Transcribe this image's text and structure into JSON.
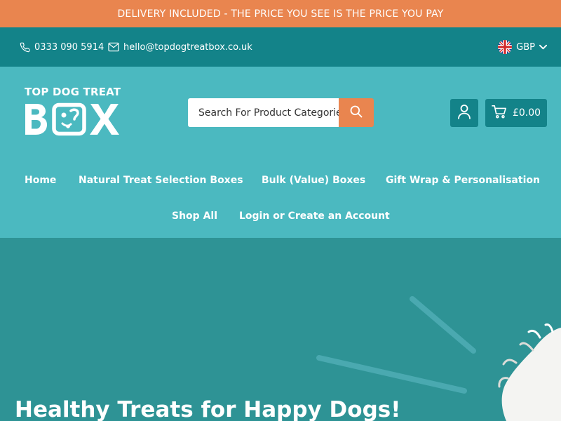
{
  "announcement": {
    "text": "DELIVERY INCLUDED - THE PRICE YOU SEE IS THE PRICE YOU PAY"
  },
  "contact": {
    "phone": "0333 090 5914",
    "email": "hello@topdogtreatbox.co.uk",
    "currency": "GBP",
    "icons": {
      "phone": "phone-icon",
      "email": "envelope-icon",
      "flag": "uk-flag-icon",
      "chevron": "chevron-down-icon"
    }
  },
  "logo": {
    "top_text": "TOP DOG TREAT",
    "bottom_text": "BOX"
  },
  "search": {
    "placeholder": "Search For Product Categories",
    "icon": "search-icon"
  },
  "account": {
    "icon": "user-icon"
  },
  "cart": {
    "total": "£0.00",
    "icon": "cart-icon"
  },
  "nav": {
    "items": [
      {
        "label": "Home"
      },
      {
        "label": "Natural Treat Selection Boxes"
      },
      {
        "label": "Bulk (Value) Boxes"
      },
      {
        "label": "Gift Wrap & Personalisation"
      },
      {
        "label": "Shop All"
      },
      {
        "label": "Login or Create an Account"
      }
    ]
  },
  "hero": {
    "title": "Healthy Treats for Happy Dogs!"
  },
  "colors": {
    "announcement_bg": "#e9854f",
    "contact_bg": "#138389",
    "header_bg": "#4bb9c0",
    "hero_bg": "#2e9395",
    "accent_orange": "#e9854f"
  }
}
